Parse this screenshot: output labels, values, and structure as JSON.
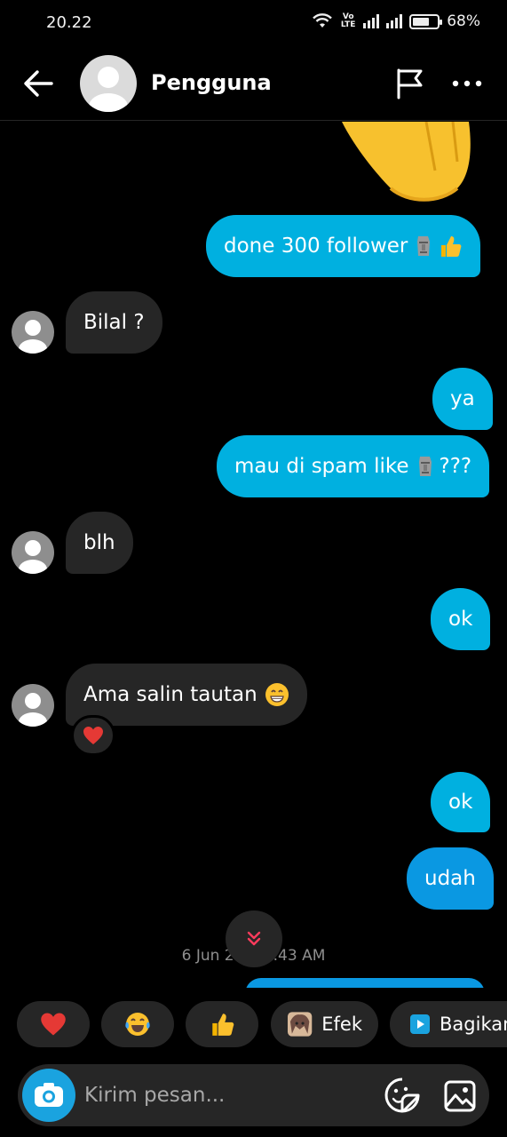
{
  "status_bar": {
    "time": "20.22",
    "volte": "Vo LTE",
    "battery": "68%",
    "battery_level": 0.68
  },
  "header": {
    "name": "Pengguna"
  },
  "messages": [
    {
      "id": "m1",
      "direction": "out",
      "text": "done 300 follower",
      "emojis": [
        "moai-icon",
        "thumbs-up-icon"
      ]
    },
    {
      "id": "m2",
      "direction": "in",
      "text": "Bilal ?"
    },
    {
      "id": "m3",
      "direction": "out",
      "text": "ya"
    },
    {
      "id": "m4",
      "direction": "out",
      "text": "mau di spam like",
      "emojis": [
        "moai-icon"
      ],
      "text_after": "???"
    },
    {
      "id": "m5",
      "direction": "in",
      "text": "blh"
    },
    {
      "id": "m6",
      "direction": "out",
      "text": "ok"
    },
    {
      "id": "m7",
      "direction": "in",
      "text": "Ama salin tautan",
      "emojis": [
        "grinning-face-icon"
      ],
      "reaction": "heart-icon"
    },
    {
      "id": "m8",
      "direction": "out",
      "text": "ok"
    },
    {
      "id": "m9",
      "direction": "out",
      "text": "udah"
    }
  ],
  "timestamp": "6 Jun 20… 7.43 AM",
  "quick_replies": [
    {
      "icon": "heart-icon"
    },
    {
      "icon": "tears-of-joy-icon"
    },
    {
      "icon": "thumbs-up-icon"
    },
    {
      "icon": "effect-avatar-icon",
      "label": "Efek"
    },
    {
      "icon": "share-play-icon",
      "label": "Bagikan"
    }
  ],
  "composer": {
    "placeholder": "Kirim pesan..."
  },
  "colors": {
    "outgoing": "#00b0e0",
    "outgoing_latest": "#0a98e2",
    "incoming": "#262626",
    "background": "#000000",
    "camera_button": "#1aa3df"
  }
}
